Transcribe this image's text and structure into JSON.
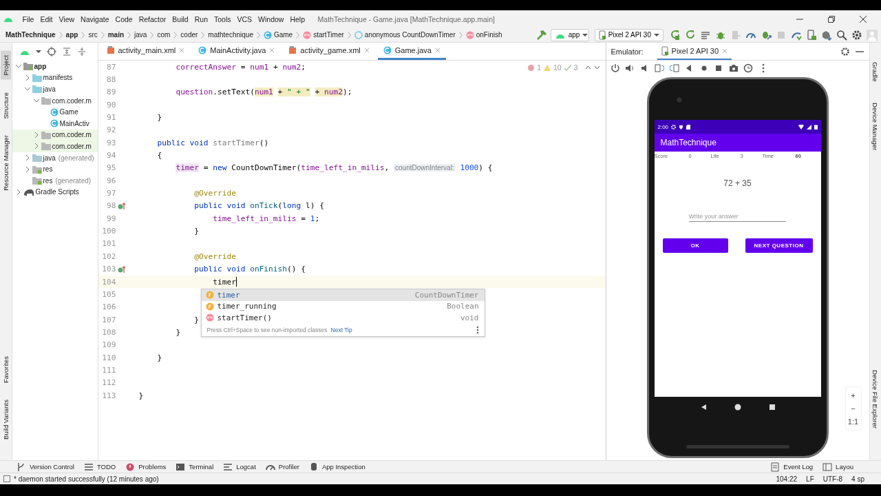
{
  "window": {
    "title": "MathTechnique - Game.java [MathTechnique.app.main]"
  },
  "menu": [
    "File",
    "Edit",
    "View",
    "Navigate",
    "Code",
    "Refactor",
    "Build",
    "Run",
    "Tools",
    "VCS",
    "Window",
    "Help"
  ],
  "breadcrumb": [
    {
      "label": "MathTechnique",
      "kind": "bold"
    },
    {
      "label": "app",
      "kind": "bold"
    },
    {
      "label": "src",
      "kind": "plain"
    },
    {
      "label": "main",
      "kind": "bold"
    },
    {
      "label": "java",
      "kind": "plain"
    },
    {
      "label": "com",
      "kind": "plain"
    },
    {
      "label": "coder",
      "kind": "plain"
    },
    {
      "label": "mathtechnique",
      "kind": "plain"
    },
    {
      "label": "Game",
      "kind": "class"
    },
    {
      "label": "startTimer",
      "kind": "method"
    },
    {
      "label": "anonymous CountDownTimer",
      "kind": "anonymous"
    },
    {
      "label": "onFinish",
      "kind": "method"
    }
  ],
  "toolbar": {
    "config": "app",
    "device": "Pixel 2 API 30"
  },
  "left_tool_tabs": [
    {
      "label": "Project",
      "selected": true
    },
    {
      "label": "Structure",
      "selected": false
    },
    {
      "label": "Resource Manager",
      "selected": false
    }
  ],
  "left_bottom_tabs": [
    {
      "label": "Favorites",
      "selected": false
    },
    {
      "label": "Build Variants",
      "selected": false
    }
  ],
  "project_tree": [
    {
      "label": "app",
      "kind": "module",
      "expanded": true,
      "children": [
        {
          "label": "manifests",
          "kind": "folder",
          "expanded": false
        },
        {
          "label": "java",
          "kind": "folder",
          "expanded": true,
          "children": [
            {
              "label": "com.coder.m",
              "kind": "package",
              "expanded": true,
              "children": [
                {
                  "label": "Game",
                  "kind": "class"
                },
                {
                  "label": "MainActiv",
                  "kind": "class"
                }
              ]
            },
            {
              "label": "com.coder.m",
              "kind": "testpackage",
              "expanded": false
            },
            {
              "label": "com.coder.m",
              "kind": "testpackage",
              "expanded": false
            }
          ]
        },
        {
          "label": "java",
          "suffix": "(generated)",
          "kind": "genfolder",
          "expanded": false
        },
        {
          "label": "res",
          "kind": "resfolder",
          "expanded": false
        },
        {
          "label": "res",
          "suffix": "(generated)",
          "kind": "resfolder"
        }
      ]
    },
    {
      "label": "Gradle Scripts",
      "kind": "gradle",
      "expanded": false
    }
  ],
  "editor_tabs": [
    {
      "label": "activity_main.xml",
      "kind": "xml",
      "selected": false
    },
    {
      "label": "MainActivity.java",
      "kind": "class",
      "selected": false
    },
    {
      "label": "activity_game.xml",
      "kind": "xml",
      "selected": false
    },
    {
      "label": "Game.java",
      "kind": "class",
      "selected": true
    }
  ],
  "inspections": {
    "errors": "1",
    "warnings": "10",
    "typos": "3"
  },
  "code": [
    {
      "number": "87",
      "current": false,
      "override": false,
      "tokens": [
        {
          "kind": "field",
          "text": "        correctAnswer"
        },
        {
          "kind": "plain",
          "text": " = "
        },
        {
          "kind": "field",
          "text": "num1"
        },
        {
          "kind": "plain",
          "text": " + "
        },
        {
          "kind": "field",
          "text": "num2"
        },
        {
          "kind": "plain",
          "text": ";"
        }
      ]
    },
    {
      "number": "88",
      "current": false,
      "override": false
    },
    {
      "number": "89",
      "current": false,
      "override": false,
      "tokens": [
        {
          "kind": "field",
          "text": "        question"
        },
        {
          "kind": "plain",
          "text": ".setText("
        },
        {
          "kind": "hlfield",
          "text": "num1"
        },
        {
          "kind": "hlplain",
          "text": " + "
        },
        {
          "kind": "hlstring",
          "text": "\" + \""
        },
        {
          "kind": "hlplain",
          "text": " + "
        },
        {
          "kind": "hlfield",
          "text": "num2"
        },
        {
          "kind": "plain",
          "text": ");"
        }
      ]
    },
    {
      "number": "90",
      "current": false,
      "override": false
    },
    {
      "number": "91",
      "current": false,
      "override": false,
      "tokens": [
        {
          "kind": "plain",
          "text": "    }"
        }
      ]
    },
    {
      "number": "92",
      "current": false,
      "override": false
    },
    {
      "number": "93",
      "current": false,
      "override": false,
      "tokens": [
        {
          "kind": "keyword",
          "text": "    public void "
        },
        {
          "kind": "unused",
          "text": "startTimer"
        },
        {
          "kind": "plain",
          "text": "()"
        }
      ]
    },
    {
      "number": "94",
      "current": false,
      "override": false,
      "tokens": [
        {
          "kind": "plain",
          "text": "    {"
        }
      ]
    },
    {
      "number": "95",
      "current": false,
      "override": false,
      "tokens": [
        {
          "kind": "usage",
          "text": "        timer"
        },
        {
          "kind": "plain",
          "text": " = "
        },
        {
          "kind": "keyword",
          "text": "new "
        },
        {
          "kind": "plain",
          "text": "CountDownTimer("
        },
        {
          "kind": "field",
          "text": "time_left_in_milis"
        },
        {
          "kind": "plain",
          "text": ", "
        },
        {
          "kind": "hint",
          "text": "countDownInterval:"
        },
        {
          "kind": "number",
          "text": " 1000"
        },
        {
          "kind": "plain",
          "text": ") {"
        }
      ]
    },
    {
      "number": "96",
      "current": false,
      "override": false
    },
    {
      "number": "97",
      "current": false,
      "override": false,
      "tokens": [
        {
          "kind": "annotation",
          "text": "            @Override"
        }
      ]
    },
    {
      "number": "98",
      "current": false,
      "override": true,
      "tokens": [
        {
          "kind": "keyword",
          "text": "            public void "
        },
        {
          "kind": "method",
          "text": "onTick"
        },
        {
          "kind": "plain",
          "text": "("
        },
        {
          "kind": "keyword",
          "text": "long "
        },
        {
          "kind": "plain",
          "text": "l) {"
        }
      ]
    },
    {
      "number": "99",
      "current": false,
      "override": false,
      "tokens": [
        {
          "kind": "field",
          "text": "                time_left_in_milis"
        },
        {
          "kind": "plain",
          "text": " = "
        },
        {
          "kind": "number",
          "text": "1"
        },
        {
          "kind": "plain",
          "text": ";"
        }
      ]
    },
    {
      "number": "100",
      "current": false,
      "override": false,
      "tokens": [
        {
          "kind": "plain",
          "text": "            }"
        }
      ]
    },
    {
      "number": "101",
      "current": false,
      "override": false
    },
    {
      "number": "102",
      "current": false,
      "override": false,
      "tokens": [
        {
          "kind": "annotation",
          "text": "            @Override"
        }
      ]
    },
    {
      "number": "103",
      "current": false,
      "override": true,
      "tokens": [
        {
          "kind": "keyword",
          "text": "            public void "
        },
        {
          "kind": "method",
          "text": "onFinish"
        },
        {
          "kind": "plain",
          "text": "() {"
        }
      ]
    },
    {
      "number": "104",
      "current": true,
      "override": false,
      "tokens": [
        {
          "kind": "plain",
          "text": "                timer"
        }
      ]
    },
    {
      "number": "105",
      "current": false,
      "override": false
    },
    {
      "number": "106",
      "current": false,
      "override": false
    },
    {
      "number": "107",
      "current": false,
      "override": false,
      "tokens": [
        {
          "kind": "plain",
          "text": "            }"
        }
      ]
    },
    {
      "number": "108",
      "current": false,
      "override": false,
      "tokens": [
        {
          "kind": "plain",
          "text": "        }"
        }
      ]
    },
    {
      "number": "109",
      "current": false,
      "override": false
    },
    {
      "number": "110",
      "current": false,
      "override": false,
      "tokens": [
        {
          "kind": "plain",
          "text": "    }"
        }
      ]
    },
    {
      "number": "111",
      "current": false,
      "override": false
    },
    {
      "number": "112",
      "current": false,
      "override": false
    },
    {
      "number": "113",
      "current": false,
      "override": false,
      "tokens": [
        {
          "kind": "plain",
          "text": "}"
        }
      ]
    }
  ],
  "completion": {
    "items": [
      {
        "kind": "field",
        "name": "timer",
        "type": "CountDownTimer",
        "selected": true
      },
      {
        "kind": "field",
        "name": "timer_running",
        "type": "Boolean",
        "selected": false
      },
      {
        "kind": "method",
        "name": "startTimer()",
        "type": "void",
        "selected": false
      }
    ],
    "hint": "Press Ctrl+Space to see non-imported classes",
    "link": "Next Tip"
  },
  "emulator": {
    "label": "Emulator:",
    "tab": "Pixel 2 API 30",
    "zoom": [
      "+",
      "−",
      "1:1"
    ]
  },
  "phone": {
    "time": "2:00",
    "app_title": "MathTechnique",
    "stats": [
      "Score",
      "0",
      "Life",
      "3",
      "Time",
      "60"
    ],
    "question": "72 + 35",
    "answer_placeholder": "Write your answer",
    "buttons": [
      "OK",
      "NEXT QUESTION"
    ]
  },
  "right_tool_tabs": [
    {
      "label": "Gradle"
    },
    {
      "label": "Device Manager"
    },
    {
      "label": "Device File Explorer"
    }
  ],
  "bottom_tabs": [
    {
      "label": "Version Control",
      "kind": "vcs"
    },
    {
      "label": "TODO",
      "kind": "todo"
    },
    {
      "label": "Problems",
      "kind": "problems"
    },
    {
      "label": "Terminal",
      "kind": "terminal"
    },
    {
      "label": "Logcat",
      "kind": "logcat"
    },
    {
      "label": "Profiler",
      "kind": "profiler"
    },
    {
      "label": "App Inspection",
      "kind": "inspection"
    }
  ],
  "bottom_right_tabs": [
    {
      "label": "Event Log"
    },
    {
      "label": "Layou"
    }
  ],
  "status_bar": {
    "message": "* daemon started successfully (12 minutes ago)",
    "items": [
      "104:22",
      "LF",
      "UTF-8",
      "4 sp"
    ]
  }
}
